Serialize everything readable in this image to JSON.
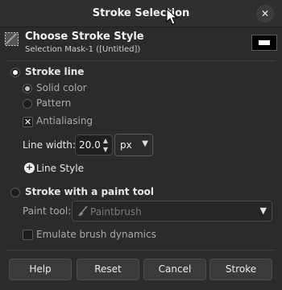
{
  "window": {
    "title": "Stroke Selection"
  },
  "header": {
    "title": "Choose Stroke Style",
    "subtitle": "Selection Mask-1 ([Untitled])"
  },
  "stroke_line": {
    "label": "Stroke line",
    "selected": true,
    "solid_color_label": "Solid color",
    "solid_color_selected": true,
    "pattern_label": "Pattern",
    "pattern_selected": false,
    "antialiasing_label": "Antialiasing",
    "antialiasing_checked": true,
    "line_width_label": "Line width:",
    "line_width_value": "20.0",
    "unit_value": "px",
    "line_style_label": "Line Style"
  },
  "paint_tool": {
    "label": "Stroke with a paint tool",
    "selected": false,
    "tool_label": "Paint tool:",
    "tool_value": "Paintbrush",
    "emulate_label": "Emulate brush dynamics",
    "emulate_checked": false
  },
  "buttons": {
    "help": "Help",
    "reset": "Reset",
    "cancel": "Cancel",
    "stroke": "Stroke"
  },
  "icons": {
    "close": "close-icon",
    "header": "stroke-selection-icon",
    "brush": "paintbrush-icon"
  }
}
